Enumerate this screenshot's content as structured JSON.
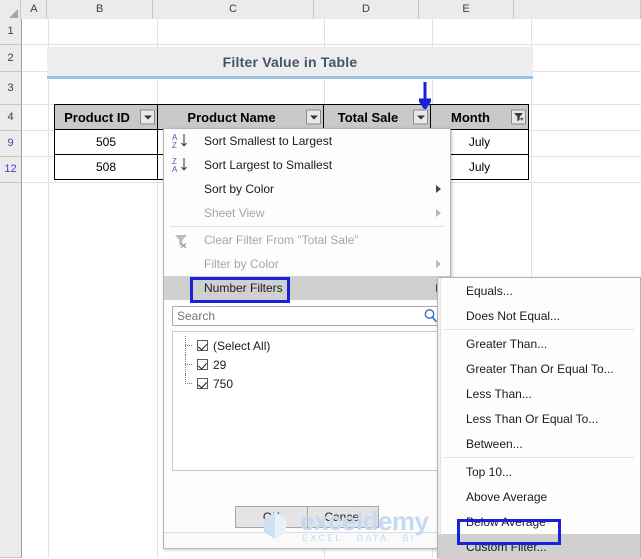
{
  "app": "excel-filter-dropdown",
  "grid": {
    "column_headers": [
      "A",
      "B",
      "C",
      "D",
      "E"
    ],
    "row_headers": [
      "1",
      "2",
      "3",
      "4",
      "9",
      "12"
    ],
    "filtered_rows": [
      "9",
      "12"
    ]
  },
  "banner": {
    "title": "Filter Value in Table"
  },
  "table": {
    "headers": [
      {
        "label": "Product ID",
        "filter_icon": "dropdown-caret"
      },
      {
        "label": "Product Name",
        "filter_icon": "dropdown-caret"
      },
      {
        "label": "Total Sale",
        "filter_icon": "dropdown-caret"
      },
      {
        "label": "Month",
        "filter_icon": "funnel-filtered"
      }
    ],
    "rows": [
      {
        "product_id": "505",
        "product_name": "",
        "total_sale": "",
        "month": "July"
      },
      {
        "product_id": "508",
        "product_name": "",
        "total_sale": "",
        "month": "July"
      }
    ]
  },
  "dropdown": {
    "items": [
      {
        "label": "Sort Smallest to Largest",
        "underline": "S",
        "icon": "sort-az-icon",
        "disabled": false,
        "submenu": false
      },
      {
        "label": "Sort Largest to Smallest",
        "underline": "o",
        "icon": "sort-za-icon",
        "disabled": false,
        "submenu": false
      },
      {
        "label": "Sort by Color",
        "underline": "t",
        "icon": "none",
        "disabled": false,
        "submenu": true
      },
      {
        "label": "Sheet View",
        "underline": "V",
        "icon": "none",
        "disabled": true,
        "submenu": true
      },
      {
        "label": "Clear Filter From \"Total Sale\"",
        "underline": "C",
        "icon": "clear-filter-icon",
        "disabled": true,
        "submenu": false
      },
      {
        "label": "Filter by Color",
        "underline": "i",
        "icon": "none",
        "disabled": true,
        "submenu": true
      },
      {
        "label": "Number Filters",
        "underline": "F",
        "icon": "none",
        "disabled": false,
        "submenu": true,
        "selected": true
      }
    ],
    "search": {
      "placeholder": "Search",
      "value": "",
      "icon": "search-icon"
    },
    "checklist": [
      {
        "label": "(Select All)",
        "checked": true
      },
      {
        "label": "29",
        "checked": true
      },
      {
        "label": "750",
        "checked": true
      }
    ],
    "buttons": {
      "ok": "OK",
      "cancel": "Cancel"
    }
  },
  "submenu": {
    "items": [
      {
        "label": "Equals...",
        "underline": "E",
        "sep_after": false
      },
      {
        "label": "Does Not Equal...",
        "underline": "N",
        "sep_after": true
      },
      {
        "label": "Greater Than...",
        "underline": "G",
        "sep_after": false
      },
      {
        "label": "Greater Than Or Equal To...",
        "underline": "O",
        "sep_after": false
      },
      {
        "label": "Less Than...",
        "underline": "L",
        "sep_after": false
      },
      {
        "label": "Less Than Or Equal To...",
        "underline": "q",
        "sep_after": false
      },
      {
        "label": "Between...",
        "underline": "w",
        "sep_after": true
      },
      {
        "label": "Top 10...",
        "underline": "T",
        "sep_after": false
      },
      {
        "label": "Above Average",
        "underline": "A",
        "sep_after": false
      },
      {
        "label": "Below Average",
        "underline": "o",
        "sep_after": false
      },
      {
        "label": "Custom Filter...",
        "underline": "F",
        "sep_after": false,
        "selected": true
      }
    ]
  },
  "annotations": {
    "arrow_color": "#1a22d8",
    "box_color": "#1a22d8",
    "targets": [
      "total-sale-filter-button",
      "number-filters-item",
      "custom-filter-item"
    ]
  },
  "watermark": {
    "name": "exceldemy",
    "tagline": "EXCEL · DATA · BI"
  }
}
